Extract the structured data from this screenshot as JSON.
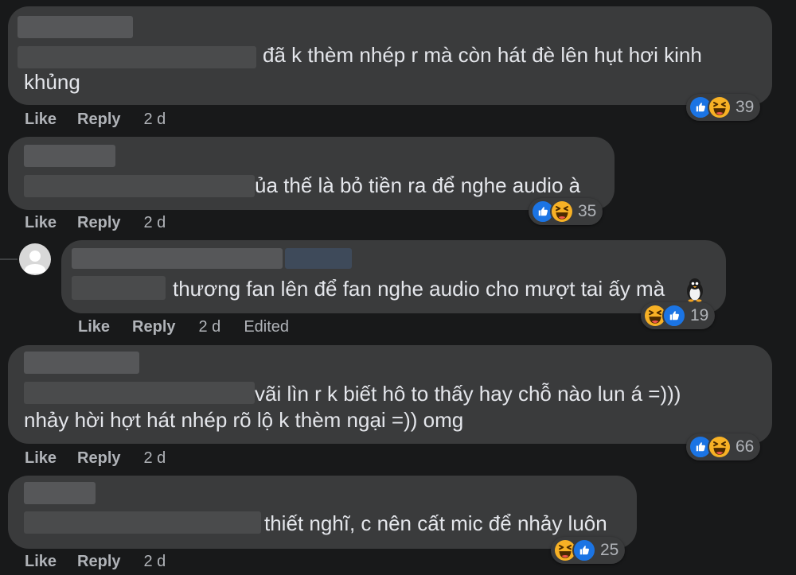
{
  "comments": [
    {
      "text": "đã k thèm nhép r mà còn hát đè lên hụt hơi kinh",
      "text2": "khủng",
      "reaction_count": "39",
      "like_label": "Like",
      "reply_label": "Reply",
      "time": "2 d"
    },
    {
      "text": "ủa thế là bỏ tiền ra để nghe audio à",
      "reaction_count": "35",
      "like_label": "Like",
      "reply_label": "Reply",
      "time": "2 d"
    },
    {
      "text": "thương fan lên để fan nghe audio cho mượt tai ấy mà",
      "reaction_count": "19",
      "like_label": "Like",
      "reply_label": "Reply",
      "time": "2 d",
      "edited_label": "Edited"
    },
    {
      "text": "vãi lìn r k biết hô to thấy hay chỗ nào lun á =)))",
      "text2": "nhảy hời hợt hát nhép rõ lộ k thèm ngại =)) omg",
      "reaction_count": "66",
      "like_label": "Like",
      "reply_label": "Reply",
      "time": "2 d"
    },
    {
      "text": "thiết nghĩ, c nên cất mic để nhảy luôn",
      "reaction_count": "25",
      "like_label": "Like",
      "reply_label": "Reply",
      "time": "2 d"
    }
  ],
  "icons": {
    "like": "like-icon",
    "haha": "haha-icon",
    "penguin": "penguin-emoji-icon",
    "avatar": "default-avatar-icon"
  },
  "colors": {
    "background": "#18191a",
    "bubble": "#3a3b3c",
    "text": "#e4e6eb",
    "secondary_text": "#b0b3b8",
    "like_blue": "#1b74e4",
    "haha_yellow": "#f7b125"
  }
}
